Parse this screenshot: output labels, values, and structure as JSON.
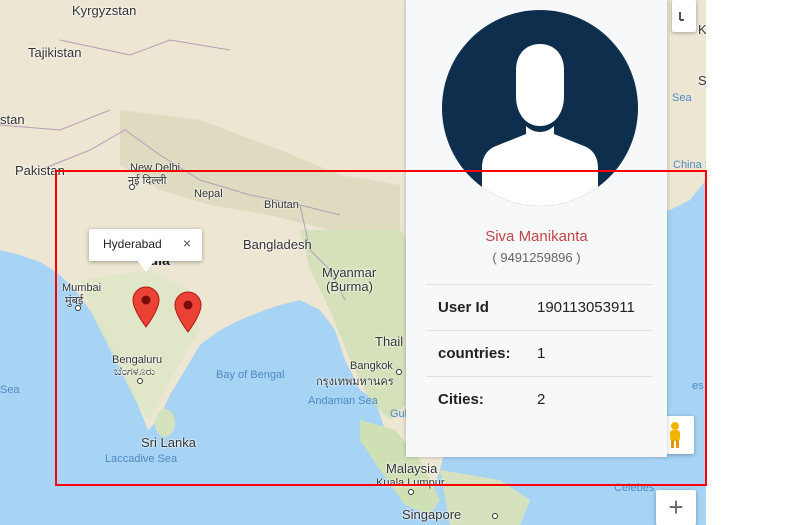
{
  "map": {
    "labels": {
      "kyrgyzstan": "Kyrgyzstan",
      "tajikistan": "Tajikistan",
      "stan": "stan",
      "pakistan": "Pakistan",
      "new_delhi": "New Delhi",
      "new_delhi_local": "नई दिल्ली",
      "nepal": "Nepal",
      "bhutan": "Bhutan",
      "bangladesh": "Bangladesh",
      "india_fragment": "ndia",
      "mumbai": "Mumbai",
      "mumbai_local": "मुंबई",
      "myanmar": "Myanmar",
      "burma": "(Burma)",
      "thailand_fragment": "Thail",
      "bengaluru": "Bengaluru",
      "bengaluru_local": "ಬೆಂಗಳೂರು",
      "bay_of_bengal": "Bay of Bengal",
      "bangkok": "Bangkok",
      "bangkok_local": "กรุงเทพมหานคร",
      "andaman_sea": "Andaman Sea",
      "gulf": "Gul",
      "sea_fragment": "Sea",
      "sri_lanka": "Sri Lanka",
      "laccadive_sea": "Laccadive Sea",
      "malaysia": "Malaysia",
      "kuala_lumpur": "Kuala Lumpur",
      "singapore": "Singapore",
      "china_sea_fragment": "China S",
      "celebes_fragment": "Celebes",
      "right_sea_fragment": "Sea",
      "right_s_fragment": "S",
      "right_k_fragment": "K",
      "right_es_fragment": "es"
    },
    "infowindow": {
      "city": "Hyderabad",
      "close_glyph": "×"
    },
    "markers": [
      "Hyderabad",
      "Vijayawada"
    ],
    "controls": {
      "fullscreen_icon": "fullscreen-icon",
      "zoom_in_glyph": "+",
      "pegman_icon": "pegman-icon"
    }
  },
  "profile": {
    "avatar_icon": "user-silhouette-icon",
    "name": "Siva Manikanta",
    "phone": "( 9491259896 )",
    "rows": [
      {
        "label": "User Id",
        "value": "190113053911"
      },
      {
        "label": "countries:",
        "value": "1"
      },
      {
        "label": "Cities:",
        "value": "2"
      }
    ]
  },
  "colors": {
    "avatar_bg": "#0e2e4e",
    "name_color": "#c44646",
    "highlight_border": "#ff0000",
    "marker_red": "#ea4335",
    "water": "#a7d3f4",
    "land": "#ece6d3"
  }
}
